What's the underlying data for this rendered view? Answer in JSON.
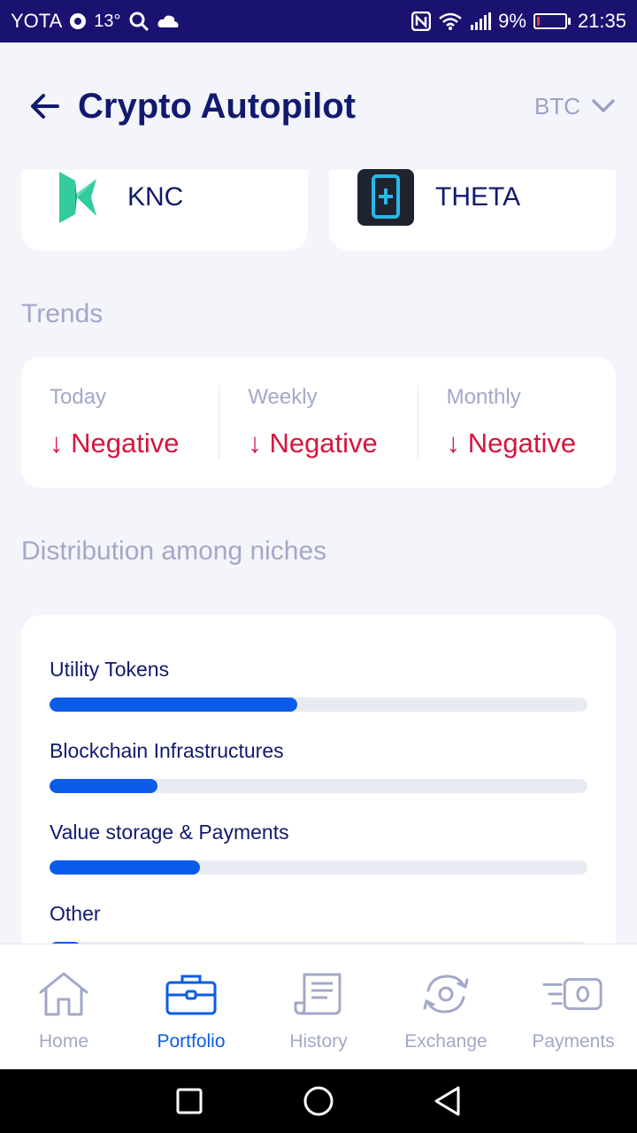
{
  "status_bar": {
    "carrier": "YOTA",
    "temperature": "13°",
    "battery": "9%",
    "time": "21:35",
    "battery_level": 0.09
  },
  "header": {
    "title": "Crypto Autopilot",
    "currency": "BTC",
    "back_icon": "arrow-left-icon",
    "dropdown_icon": "chevron-down-icon"
  },
  "coins": [
    {
      "name": "KNC",
      "icon": "kyber-network-logo"
    },
    {
      "name": "THETA",
      "icon": "theta-logo"
    }
  ],
  "trends": {
    "title": "Trends",
    "items": [
      {
        "label": "Today",
        "value": "↓ Negative"
      },
      {
        "label": "Weekly",
        "value": "↓ Negative"
      },
      {
        "label": "Monthly",
        "value": "↓ Negative"
      }
    ],
    "negative_color": "#d7143f"
  },
  "distribution": {
    "title": "Distribution among niches",
    "items": [
      {
        "label": "Utility Tokens",
        "share": 0.46
      },
      {
        "label": "Blockchain Infrastructures",
        "share": 0.2
      },
      {
        "label": "Value storage & Payments",
        "share": 0.28
      },
      {
        "label": "Other",
        "share": 0.06
      }
    ],
    "bar_color": "#0b5ce8"
  },
  "bottom_nav": {
    "items": [
      {
        "label": "Home",
        "icon": "home-icon",
        "active": false
      },
      {
        "label": "Portfolio",
        "icon": "briefcase-icon",
        "active": true
      },
      {
        "label": "History",
        "icon": "receipt-icon",
        "active": false
      },
      {
        "label": "Exchange",
        "icon": "exchange-icon",
        "active": false
      },
      {
        "label": "Payments",
        "icon": "fast-payment-icon",
        "active": false
      }
    ],
    "active_color": "#0b5ce8"
  },
  "system_nav": {
    "buttons": [
      "recent-apps-icon",
      "home-circle-icon",
      "back-triangle-icon"
    ]
  }
}
